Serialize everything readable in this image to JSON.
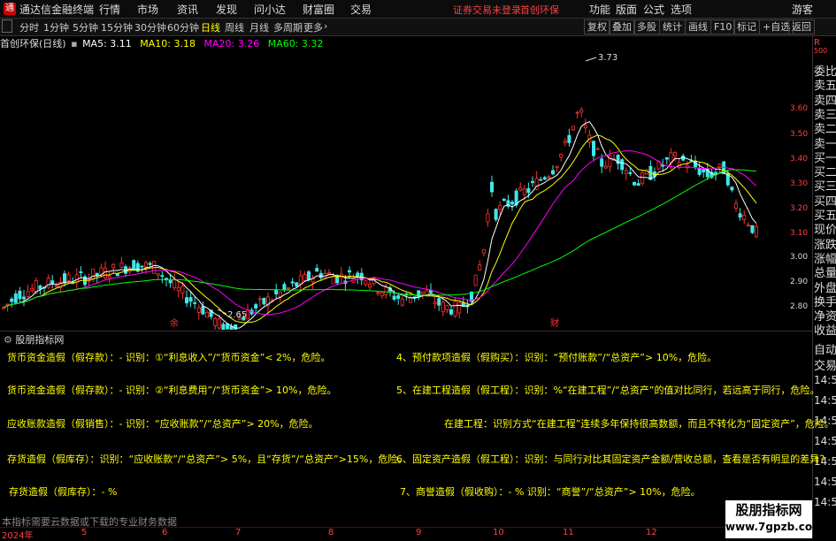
{
  "menubar": {
    "app_title": "通达信金融终端",
    "menus": [
      "行情",
      "市场",
      "资讯",
      "发现",
      "问小达",
      "财富圈",
      "交易"
    ],
    "login_warning": "证券交易未登录",
    "stock_name": "首创环保",
    "right_menus": [
      "功能",
      "版面",
      "公式",
      "选项"
    ],
    "guest": "游客"
  },
  "periodbar": {
    "periods": [
      "分时",
      "1分钟",
      "5分钟",
      "15分钟",
      "30分钟",
      "60分钟",
      "日线",
      "周线",
      "月线",
      "多周期",
      "更多"
    ],
    "active": "日线",
    "buttons": [
      "复权",
      "叠加",
      "多股",
      "统计",
      "画线",
      "F10",
      "标记",
      "+自选",
      "返回"
    ]
  },
  "chart": {
    "stock_label": "首创环保(日线)",
    "ma": [
      {
        "label": "MA5: 3.11",
        "color": "#ffffff"
      },
      {
        "label": "MA10: 3.18",
        "color": "#ffff00"
      },
      {
        "label": "MA20: 3.26",
        "color": "#ff00ff"
      },
      {
        "label": "MA60: 3.32",
        "color": "#00ff00"
      }
    ],
    "price_axis": [
      "3.60",
      "3.50",
      "3.40",
      "3.30",
      "3.20",
      "3.10",
      "3.00",
      "2.90",
      "2.80"
    ],
    "high_marker": "3.73",
    "low_marker": "2.65",
    "event_marks": [
      "余",
      "财"
    ]
  },
  "sidebar": {
    "top_label": "R",
    "top_sub": "500",
    "items": [
      "委比",
      "卖五",
      "卖四",
      "卖三",
      "卖二",
      "卖一",
      "买一",
      "买二",
      "买三",
      "买四",
      "买五",
      "现价",
      "涨跌",
      "涨幅",
      "总量",
      "外盘",
      "换手",
      "净资",
      "收益"
    ],
    "auto": "自动",
    "trade": "交易",
    "times": [
      "14:5",
      "14:5",
      "14:5",
      "14:5",
      "14:5",
      "14:5",
      "14:5"
    ]
  },
  "indicator": {
    "title": "股朋指标网",
    "lines": [
      [
        "货币资金造假（假存款）：",
        "- 识别：①“利息收入”/“货币资金”< 2%，危险。"
      ],
      [
        "货币资金造假（假存款）：",
        "- 识别：②“利息费用”/“货币资金”> 10%，危险。"
      ],
      [
        "应收账款造假（假销售）：",
        "- 识别：“应收账款”/“总资产”> 20%，危险。"
      ],
      [
        "存货造假（假库存）：",
        "识别：“应收账款”/“总资产”> 5%，且“存货”/“总资产”>15%，危险。"
      ],
      [
        "存货造假（假库存）：",
        "- %"
      ],
      [
        "4、预付款项造假（假购买）：",
        "识别：“预付账款”/“总资产”> 10%，危险。"
      ],
      [
        "5、在建工程造假（假工程）：",
        "识别：%“在建工程”/“总资产”的值对比同行，若远高于同行，危险。"
      ],
      [
        "在建工程：",
        "识别方式“在建工程”连续多年保持很高数额，而且不转化为“固定资产”，危险。"
      ],
      [
        "6、固定资产造假（假工程）：",
        "识别：与同行对比其固定资产金额/营收总额，查看是否有明显的差异？"
      ],
      [
        "7、商誉造假（假收购）：",
        "- % 识别：“商誉”/“总资产”> 10%，危险。"
      ]
    ],
    "footnote": "本指标需要云数据或下载的专业财务数据"
  },
  "dateaxis": {
    "labels": [
      "2024年",
      "5",
      "6",
      "7",
      "8",
      "9",
      "10",
      "11",
      "12"
    ]
  },
  "watermark": {
    "line1": "股朋指标网",
    "line2": "www.7gpzb.com"
  },
  "colors": {
    "up": "#ff3030",
    "down": "#3ee8e8",
    "ma5": "#ffffff",
    "ma10": "#ffff00",
    "ma20": "#ff00ff",
    "ma60": "#00ff00"
  }
}
